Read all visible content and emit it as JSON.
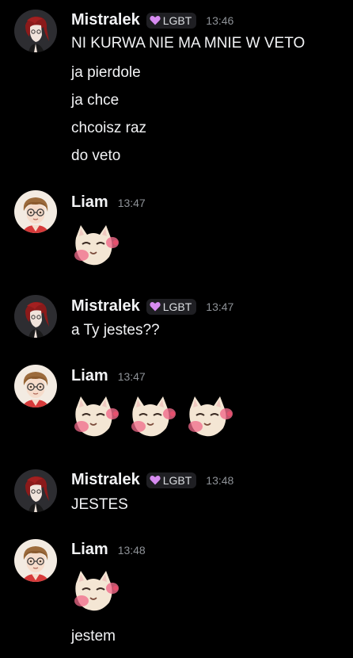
{
  "role": {
    "label": "LGBT",
    "heart_color": "#d68bf0",
    "icon": "purple-heart-icon"
  },
  "messages": [
    {
      "author": "Mistralek",
      "time": "13:46",
      "has_role": true,
      "lines": [
        "NI KURWA NIE MA MNIE W VETO",
        "ja pierdole",
        "ja chce",
        "chcoisz raz",
        "do veto"
      ]
    },
    {
      "author": "Liam",
      "time": "13:47",
      "emotes": 1,
      "emote_name": "blushing-cat-emote"
    },
    {
      "author": "Mistralek",
      "time": "13:47",
      "has_role": true,
      "lines": [
        "a Ty jestes??"
      ]
    },
    {
      "author": "Liam",
      "time": "13:47",
      "emotes": 3,
      "emote_name": "blushing-cat-emote"
    },
    {
      "author": "Mistralek",
      "time": "13:48",
      "has_role": true,
      "lines": [
        "JESTES"
      ]
    },
    {
      "author": "Liam",
      "time": "13:48",
      "emotes": 1,
      "emote_name": "blushing-cat-emote",
      "lines": [
        "jestem"
      ]
    }
  ],
  "colors": {
    "background": "#000000",
    "text": "#f2f3f5",
    "timestamp": "#8e9297",
    "role_bg": "#1f1f23"
  }
}
